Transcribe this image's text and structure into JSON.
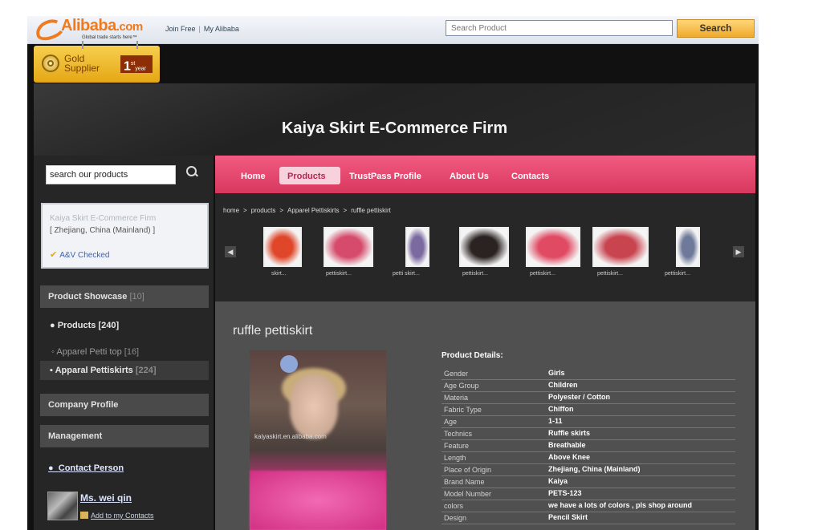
{
  "header": {
    "brand": "Alibaba",
    "brand_suffix": ".com",
    "tagline": "Global trade starts here™",
    "links": [
      "Join Free",
      "My Alibaba"
    ],
    "search_placeholder": "Search Product",
    "search_button": "Search"
  },
  "gold_supplier": {
    "label_line1": "Gold",
    "label_line2": "Supplier",
    "years": "1",
    "years_sup": "st",
    "years_unit": "year"
  },
  "banner": {
    "title": "Kaiya Skirt E-Commerce Firm"
  },
  "sidebar": {
    "search_value": "search our products",
    "company": {
      "name": "Kaiya Skirt E-Commerce Firm",
      "location": "[ Zhejiang, China (Mainland) ]",
      "verified": "A&V Checked"
    },
    "showcase": {
      "label": "Product Showcase",
      "count": "[10]"
    },
    "products": "Products [240]",
    "categories": [
      {
        "label": "Apparel Petti top",
        "count": "[16]"
      },
      {
        "label": "Apparal Pettiskirts",
        "count": "[224]"
      }
    ],
    "company_profile": "Company Profile",
    "management": "Management",
    "contact_person": "Contact Person",
    "contact_name": "Ms. wei qin",
    "add_contact": "Add to my Contacts"
  },
  "nav": {
    "items": [
      "Home",
      "Products",
      "TrustPass Profile",
      "About Us",
      "Contacts"
    ],
    "active": "Products"
  },
  "breadcrumb": [
    "home",
    "products",
    "Apparel Pettiskirts",
    "ruffle pettiskirt"
  ],
  "thumbnails": [
    {
      "label": "skirt...",
      "color": "#e0472a"
    },
    {
      "label": "pettiskirt...",
      "color": "#d64b6c"
    },
    {
      "label": "petti skirt...",
      "color": "#7a6aa0"
    },
    {
      "label": "pettiskirt...",
      "color": "#2b2322"
    },
    {
      "label": "pettiskirt...",
      "color": "#e04a62"
    },
    {
      "label": "pettiskirt...",
      "color": "#c8444f"
    },
    {
      "label": "pettiskirt...",
      "color": "#6f7a9a"
    }
  ],
  "product": {
    "title": "ruffle pettiskirt",
    "photo_watermark": "kaiyaskirt.en.alibaba.com",
    "details_heading": "Product Details:",
    "details": [
      {
        "key": "Gender",
        "value": "Girls"
      },
      {
        "key": "Age Group",
        "value": "Children"
      },
      {
        "key": "Materia",
        "value": "Polyester / Cotton"
      },
      {
        "key": "Fabric Type",
        "value": "Chiffon"
      },
      {
        "key": "Age",
        "value": "1-11"
      },
      {
        "key": "Technics",
        "value": "Ruffle skirts"
      },
      {
        "key": "Feature",
        "value": "Breathable"
      },
      {
        "key": "Length",
        "value": "Above Knee"
      },
      {
        "key": "Place of Origin",
        "value": "Zhejiang, China (Mainland)"
      },
      {
        "key": "Brand Name",
        "value": "Kaiya"
      },
      {
        "key": "Model Number",
        "value": "PETS-123"
      },
      {
        "key": "colors",
        "value": "we have a lots of colors , pls shop around"
      },
      {
        "key": "Design",
        "value": "Pencil Skirt"
      }
    ]
  }
}
